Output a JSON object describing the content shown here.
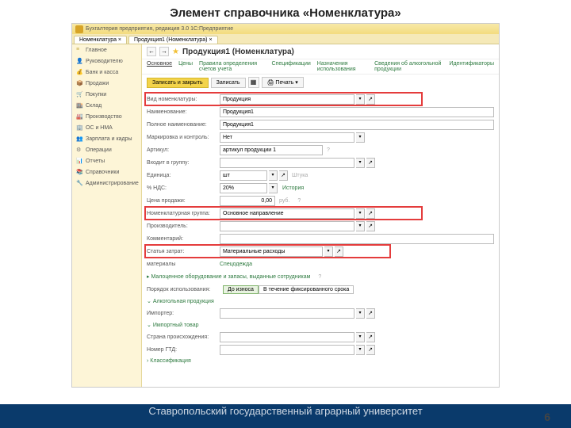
{
  "slide": {
    "title": "Элемент справочника «Номенклатура»",
    "page": "6"
  },
  "footer": {
    "text": "Ставропольский государственный аграрный университет"
  },
  "titlebar": {
    "text": "Бухгалтерия предприятия, редакция 3.0  1С:Предприятие"
  },
  "tabs": [
    "Номенклатура ×",
    "Продукция1 (Номенклатура) ×"
  ],
  "sidebar": [
    {
      "icon": "≡",
      "color": "#c2a83e",
      "label": "Главное"
    },
    {
      "icon": "👤",
      "color": "#5a9e5a",
      "label": "Руководителю"
    },
    {
      "icon": "💰",
      "color": "#5a9e5a",
      "label": "Банк и касса"
    },
    {
      "icon": "📦",
      "color": "#5a9e5a",
      "label": "Продажи"
    },
    {
      "icon": "🛒",
      "color": "#c55",
      "label": "Покупки"
    },
    {
      "icon": "🏬",
      "color": "#8a6d3b",
      "label": "Склад"
    },
    {
      "icon": "🏭",
      "color": "#8a6d3b",
      "label": "Производство"
    },
    {
      "icon": "🏢",
      "color": "#4a7",
      "label": "ОС и НМА"
    },
    {
      "icon": "👥",
      "color": "#a85",
      "label": "Зарплата и кадры"
    },
    {
      "icon": "⚙",
      "color": "#777",
      "label": "Операции"
    },
    {
      "icon": "📊",
      "color": "#5a9",
      "label": "Отчеты"
    },
    {
      "icon": "📚",
      "color": "#c78",
      "label": "Справочники"
    },
    {
      "icon": "🔧",
      "color": "#888",
      "label": "Администрирование"
    }
  ],
  "page": {
    "title": "Продукция1 (Номенклатура)"
  },
  "subtabs": [
    "Основное",
    "Цены",
    "Правила определения счетов учета",
    "Спецификации",
    "Назначения использования",
    "Сведения об алкогольной продукции",
    "Идентификаторы"
  ],
  "toolbar": {
    "save_close": "Записать и закрыть",
    "save": "Записать",
    "print": "Печать"
  },
  "fields": {
    "vid": {
      "label": "Вид номенклатуры:",
      "value": "Продукция"
    },
    "name": {
      "label": "Наименование:",
      "value": "Продукция1"
    },
    "full": {
      "label": "Полное наименование:",
      "value": "Продукция1"
    },
    "mark": {
      "label": "Маркировка и контроль:",
      "value": "Нет"
    },
    "art": {
      "label": "Артикул:",
      "value": "артикул продукции 1"
    },
    "group": {
      "label": "Входит в группу:",
      "value": ""
    },
    "unit": {
      "label": "Единица:",
      "value": "шт",
      "hint": "Штука"
    },
    "nds": {
      "label": "% НДС:",
      "value": "20%",
      "link": "История"
    },
    "price": {
      "label": "Цена продажи:",
      "value": "0,00",
      "cur": "руб."
    },
    "nomgroup": {
      "label": "Номенклатурная группа:",
      "value": "Основное направление"
    },
    "maker": {
      "label": "Производитель:",
      "value": ""
    },
    "comment": {
      "label": "Комментарий:",
      "value": ""
    },
    "cost": {
      "label": "Статья затрат:",
      "value": "Материальные расходы"
    },
    "mat": {
      "label": "материалы",
      "link": "Спецодежда"
    },
    "maloc": {
      "link": "Малоценное оборудование и запасы, выданные сотрудникам"
    },
    "usage": {
      "label": "Порядок использования:",
      "opt1": "До износа",
      "opt2": "В течение фиксированного срока"
    },
    "alco": {
      "header": "Алкогольная продукция"
    },
    "importer": {
      "label": "Импортер:",
      "value": ""
    },
    "import": {
      "header": "Импортный товар"
    },
    "country": {
      "label": "Страна происхождения:",
      "value": ""
    },
    "gtd": {
      "label": "Номер ГТД:",
      "value": ""
    },
    "class": {
      "header": "Классификация"
    }
  }
}
